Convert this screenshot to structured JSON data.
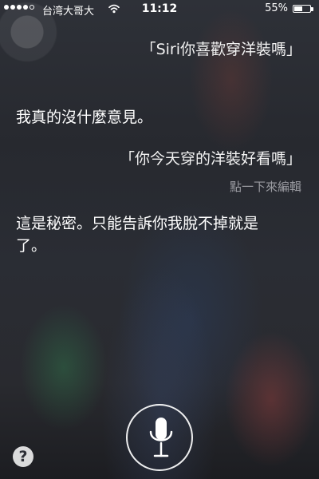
{
  "status_bar": {
    "carrier": "台湾大哥大",
    "time": "11:12",
    "battery": "55%",
    "battery_level": 0.55,
    "signal_bars": 4,
    "signal_total": 5
  },
  "conversation": {
    "user_query_1": "「Siri你喜歡穿洋裝嗎」",
    "siri_response_1": "我真的沒什麼意見。",
    "user_query_2": "「你今天穿的洋裝好看嗎」",
    "tap_to_edit": "點一下來編輯",
    "siri_response_2": "這是秘密。只能告訴你我脫不掉就是了。"
  },
  "controls": {
    "help_label": "?"
  },
  "icons": {
    "wifi": "wifi-icon",
    "battery": "battery-icon",
    "microphone": "microphone-icon",
    "help": "question-mark-icon"
  }
}
